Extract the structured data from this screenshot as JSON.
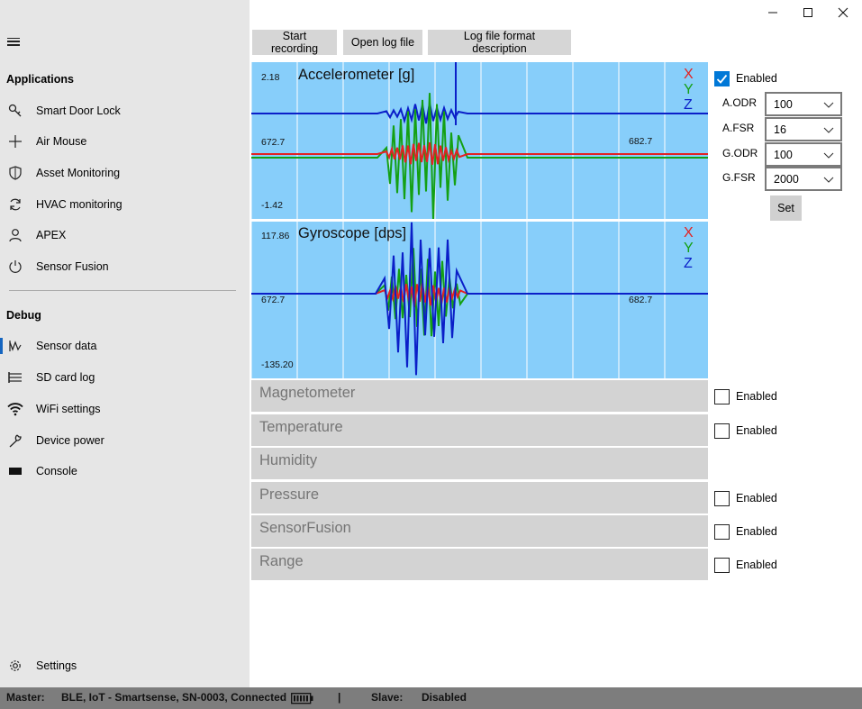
{
  "sidebar": {
    "applications_title": "Applications",
    "applications": [
      {
        "label": "Smart Door Lock",
        "icon": "key-icon"
      },
      {
        "label": "Air Mouse",
        "icon": "crosshair-icon"
      },
      {
        "label": "Asset Monitoring",
        "icon": "shield-icon"
      },
      {
        "label": "HVAC monitoring",
        "icon": "refresh-icon"
      },
      {
        "label": "APEX",
        "icon": "person-icon"
      },
      {
        "label": "Sensor Fusion",
        "icon": "power-icon"
      }
    ],
    "debug_title": "Debug",
    "debug": [
      {
        "label": "Sensor data",
        "icon": "sensor-wave-icon",
        "selected": true
      },
      {
        "label": "SD card log",
        "icon": "list-icon"
      },
      {
        "label": "WiFi settings",
        "icon": "wifi-icon"
      },
      {
        "label": "Device power",
        "icon": "wrench-icon"
      },
      {
        "label": "Console",
        "icon": "console-icon"
      }
    ],
    "settings_label": "Settings"
  },
  "toolbar": {
    "start_recording": "Start recording",
    "open_log_file": "Open log file",
    "log_format_description": "Log file format description"
  },
  "accelerometer": {
    "title": "Accelerometer [g]",
    "y_max": "2.18",
    "y_mid": "672.7",
    "y_min": "-1.42",
    "x_right": "682.7",
    "axes": [
      "X",
      "Y",
      "Z"
    ]
  },
  "gyroscope": {
    "title": "Gyroscope [dps]",
    "y_max": "117.86",
    "y_mid": "672.7",
    "y_min": "-135.20",
    "x_right": "682.7",
    "axes": [
      "X",
      "Y",
      "Z"
    ]
  },
  "settings_panel": {
    "enabled_label": "Enabled",
    "enabled_checked": true,
    "params": [
      {
        "label": "A.ODR",
        "value": "100"
      },
      {
        "label": "A.FSR",
        "value": "16"
      },
      {
        "label": "G.ODR",
        "value": "100"
      },
      {
        "label": "G.FSR",
        "value": "2000"
      }
    ],
    "set_label": "Set"
  },
  "sensors": [
    {
      "name": "Magnetometer",
      "has_enable": true,
      "enabled": false
    },
    {
      "name": "Temperature",
      "has_enable": true,
      "enabled": false
    },
    {
      "name": "Humidity",
      "has_enable": false,
      "enabled": false
    },
    {
      "name": "Pressure",
      "has_enable": true,
      "enabled": false
    },
    {
      "name": "SensorFusion",
      "has_enable": true,
      "enabled": false
    },
    {
      "name": "Range",
      "has_enable": true,
      "enabled": false
    }
  ],
  "enabled_text": "Enabled",
  "status": {
    "master_label": "Master:",
    "master_value": "BLE, IoT - Smartsense, SN-0003, Connected",
    "separator": "|",
    "slave_label": "Slave:",
    "slave_value": "Disabled"
  },
  "colors": {
    "chart_bg": "#87cefa",
    "x_axis": "#e32222",
    "y_axis": "#14a014",
    "z_axis": "#0b1fc8",
    "accent": "#0078d7"
  }
}
